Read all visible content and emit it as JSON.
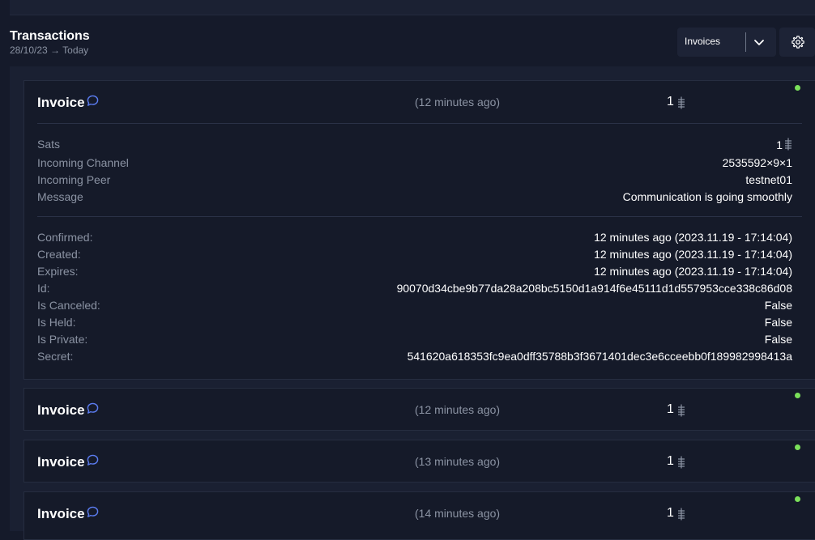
{
  "header": {
    "title": "Transactions",
    "date_range": "28/10/23 → Today"
  },
  "filter": {
    "selected": "Invoices",
    "icon": "chevron-down-icon"
  },
  "settings": {
    "icon": "gear-icon"
  },
  "colors": {
    "background": "#151a2a",
    "card": "#151a29",
    "accent": "#5b7cf0",
    "status_ok": "#7be05a"
  },
  "transactions": [
    {
      "type": "Invoice",
      "time": "(12 minutes ago)",
      "amount": "1",
      "details": [
        {
          "label": "Sats",
          "value": "1"
        },
        {
          "label": "Incoming Channel",
          "value": "2535592×9×1"
        },
        {
          "label": "Incoming Peer",
          "value": "testnet01"
        },
        {
          "label": "Message",
          "value": "Communication is going smoothly"
        }
      ],
      "info": [
        {
          "label": "Confirmed:",
          "value": "12 minutes ago (2023.11.19 - 17:14:04)"
        },
        {
          "label": "Created:",
          "value": "12 minutes ago (2023.11.19 - 17:14:04)"
        },
        {
          "label": "Expires:",
          "value": "12 minutes ago (2023.11.19 - 17:14:04)"
        },
        {
          "label": "Id:",
          "value": "90070d34cbe9b77da28a208bc5150d1a914f6e45111d1d557953cce338c86d08"
        },
        {
          "label": "Is Canceled:",
          "value": "False"
        },
        {
          "label": "Is Held:",
          "value": "False"
        },
        {
          "label": "Is Private:",
          "value": "False"
        },
        {
          "label": "Secret:",
          "value": "541620a618353fc9ea0dff35788b3f3671401dec3e6cceebb0f189982998413a"
        }
      ]
    },
    {
      "type": "Invoice",
      "time": "(12 minutes ago)",
      "amount": "1"
    },
    {
      "type": "Invoice",
      "time": "(13 minutes ago)",
      "amount": "1"
    },
    {
      "type": "Invoice",
      "time": "(14 minutes ago)",
      "amount": "1"
    }
  ]
}
